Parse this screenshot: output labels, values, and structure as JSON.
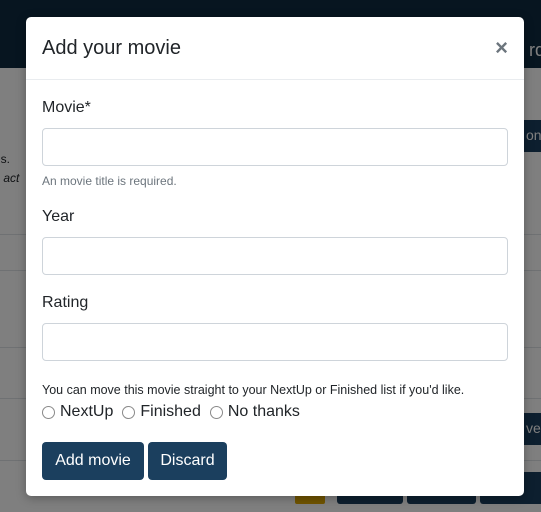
{
  "background": {
    "topbar_text": "rd",
    "text_line_1": "ns.",
    "text_line_2": "s act",
    "button_partial_1": "on",
    "button_partial_2": "ve",
    "button_partial_3": "ve"
  },
  "modal": {
    "title": "Add your movie",
    "close_symbol": "×",
    "movie_field": {
      "label": "Movie*",
      "value": "",
      "placeholder": "",
      "help_text": "An movie title is required."
    },
    "year_field": {
      "label": "Year",
      "value": "",
      "placeholder": ""
    },
    "rating_field": {
      "label": "Rating",
      "value": "",
      "placeholder": ""
    },
    "list_note": "You can move this movie straight to your NextUp or Finished list if you'd like.",
    "radio_options": [
      {
        "label": "NextUp",
        "selected": false
      },
      {
        "label": "Finished",
        "selected": false
      },
      {
        "label": "No thanks",
        "selected": false
      }
    ],
    "add_button": "Add movie",
    "discard_button": "Discard"
  },
  "colors": {
    "primary": "#1b3f5e",
    "topbar": "#0f2a40",
    "overlay": "rgba(0,0,0,0.5)"
  }
}
